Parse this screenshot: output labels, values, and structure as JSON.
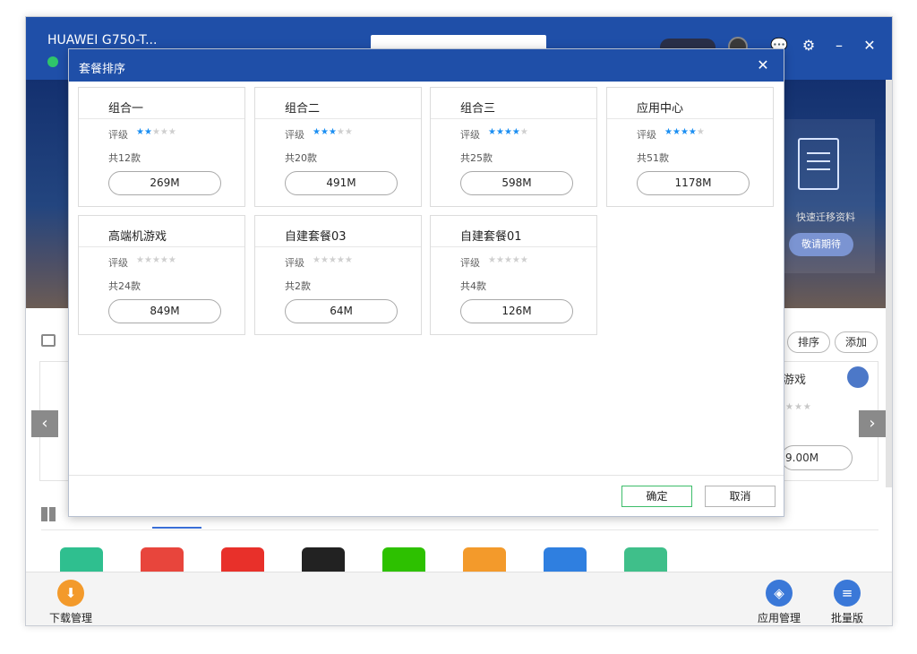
{
  "window": {
    "device_name": "HUAWEI G750-T...",
    "account_label": "",
    "icons": [
      "chat-icon",
      "gear-icon",
      "minimize-icon",
      "close-icon"
    ]
  },
  "banner": {
    "card_text": "快速迁移资料",
    "card_button": "敬请期待"
  },
  "section": {
    "sort_button": "排序",
    "add_button": "添加",
    "bg_card_title": "游戏",
    "bg_card_size": "9.00M",
    "bg_card_stars": "★★★"
  },
  "bottom_bar": {
    "download": "下载管理",
    "app_manage": "应用管理",
    "batch": "批量版"
  },
  "modal": {
    "title": "套餐排序",
    "rating_label": "评级",
    "ok": "确定",
    "cancel": "取消",
    "packages": [
      {
        "name": "组合一",
        "rating": 2,
        "count": "共12款",
        "size": "269M"
      },
      {
        "name": "组合二",
        "rating": 3,
        "count": "共20款",
        "size": "491M"
      },
      {
        "name": "组合三",
        "rating": 4,
        "count": "共25款",
        "size": "598M"
      },
      {
        "name": "应用中心",
        "rating": 4,
        "count": "共51款",
        "size": "1178M"
      },
      {
        "name": "高端机游戏",
        "rating": 0,
        "count": "共24款",
        "size": "849M"
      },
      {
        "name": "自建套餐03",
        "rating": 0,
        "count": "共2款",
        "size": "64M"
      },
      {
        "name": "自建套餐01",
        "rating": 0,
        "count": "共4款",
        "size": "126M"
      }
    ]
  },
  "colors": {
    "header_blue": "#1f4fa8",
    "star_blue": "#1c8ff2",
    "ok_green": "#3dbd6a"
  }
}
